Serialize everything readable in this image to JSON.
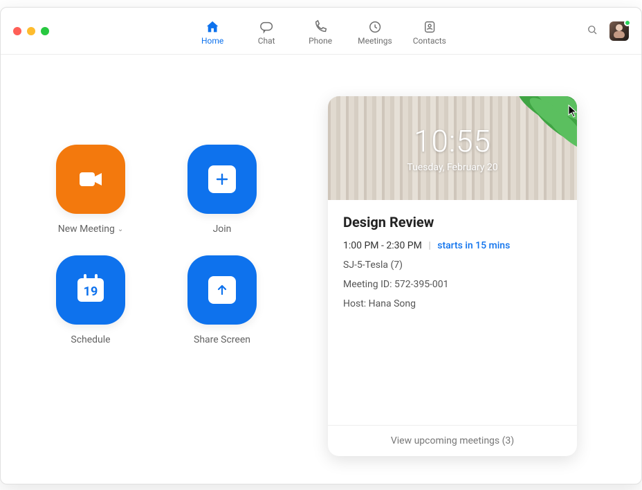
{
  "tabs": {
    "home": "Home",
    "chat": "Chat",
    "phone": "Phone",
    "meetings": "Meetings",
    "contacts": "Contacts",
    "active": "home"
  },
  "actions": {
    "new_meeting": "New Meeting",
    "join": "Join",
    "schedule": "Schedule",
    "schedule_day": "19",
    "share_screen": "Share Screen"
  },
  "clock": {
    "time": "10:55",
    "date": "Tuesday, February 20"
  },
  "event": {
    "title": "Design Review",
    "time_range": "1:00 PM - 2:30 PM",
    "starts_in": "starts in 15 mins",
    "location": "SJ-5-Tesla (7)",
    "meeting_id": "Meeting ID: 572-395-001",
    "host": "Host: Hana Song"
  },
  "footer": {
    "upcoming": "View upcoming meetings (3)"
  },
  "colors": {
    "accent": "#0e72ed",
    "orange": "#f3790d"
  }
}
